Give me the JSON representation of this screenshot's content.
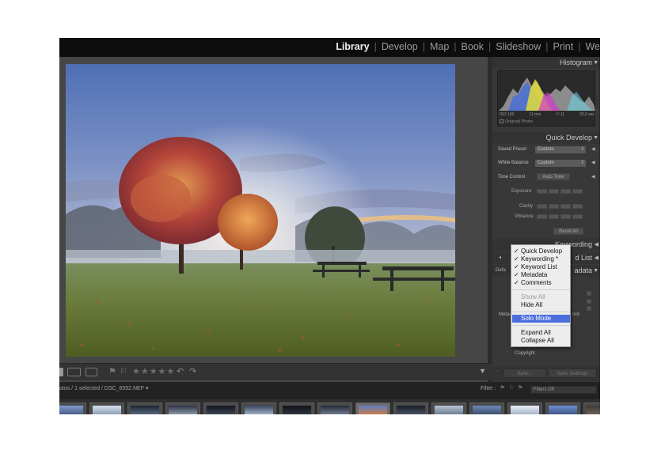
{
  "modules": [
    {
      "label": "Library",
      "active": true
    },
    {
      "label": "Develop",
      "active": false
    },
    {
      "label": "Map",
      "active": false
    },
    {
      "label": "Book",
      "active": false
    },
    {
      "label": "Slideshow",
      "active": false
    },
    {
      "label": "Print",
      "active": false
    },
    {
      "label": "We",
      "active": false
    }
  ],
  "panel": {
    "histogram_title": "Histogram",
    "histogram_meta": [
      "ISO 100",
      "11 mm",
      "f / 11",
      "25.0 sec"
    ],
    "original_photo": "Original Photo",
    "quick_develop_title": "Quick Develop",
    "saved_preset_label": "Saved Preset",
    "saved_preset_value": "Custom",
    "white_balance_label": "White Balance",
    "white_balance_value": "Custom",
    "tone_control_label": "Tone Control",
    "auto_tone": "Auto Tone",
    "exposure_label": "Exposure",
    "clarity_label": "Clarity",
    "vibrance_label": "Vibrance",
    "reset_all": "Reset All",
    "keywording_title": "Keywording",
    "keyword_list_title": "d List",
    "metadata_title": "adata",
    "metadata_partial": "Metad",
    "metadata_partial_right": "ord",
    "default_partial": "Defa",
    "copyright_label": "Copyright",
    "sync_button": "Sync...",
    "sync_settings_button": "Sync Settings"
  },
  "menu": {
    "items": [
      {
        "label": "Quick Develop",
        "checked": true
      },
      {
        "label": "Keywording *",
        "checked": true
      },
      {
        "label": "Keyword List",
        "checked": true
      },
      {
        "label": "Metadata",
        "checked": true
      },
      {
        "label": "Comments",
        "checked": true
      }
    ],
    "show_all": "Show All",
    "hide_all": "Hide All",
    "solo_mode": "Solo Mode",
    "expand_all": "Expand All",
    "collapse_all": "Collapse All"
  },
  "filmstrip": {
    "path_text": "otos / 1 selected / DSC_6592.NEF ▾",
    "filter_label": "Filter :",
    "filter_value": "Filters Off"
  },
  "toolbar": {
    "stars": "★★★★★"
  }
}
